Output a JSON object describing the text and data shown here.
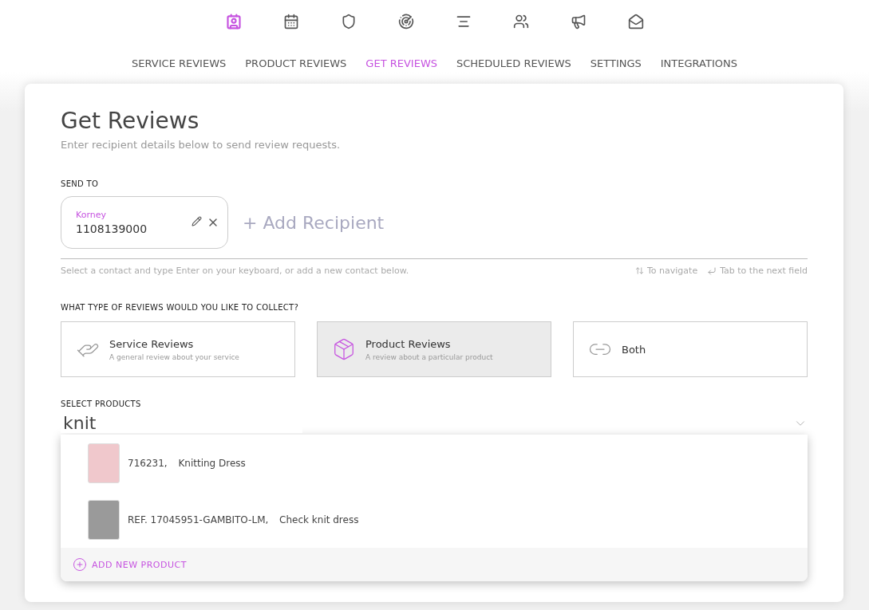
{
  "nav_icons": [
    {
      "kind": "reviews",
      "selected": true
    },
    {
      "kind": "calendar",
      "selected": false
    },
    {
      "kind": "shield",
      "selected": false
    },
    {
      "kind": "target",
      "selected": false
    },
    {
      "kind": "align",
      "selected": false
    },
    {
      "kind": "people",
      "selected": false
    },
    {
      "kind": "megaphone",
      "selected": false
    },
    {
      "kind": "mail",
      "selected": false
    }
  ],
  "tabs": [
    {
      "label": "SERVICE REVIEWS",
      "selected": false
    },
    {
      "label": "PRODUCT REVIEWS",
      "selected": false
    },
    {
      "label": "GET REVIEWS",
      "selected": true
    },
    {
      "label": "SCHEDULED REVIEWS",
      "selected": false
    },
    {
      "label": "SETTINGS",
      "selected": false
    },
    {
      "label": "INTEGRATIONS",
      "selected": false
    }
  ],
  "title": "Get Reviews",
  "subtitle": "Enter recipient details below to send review requests.",
  "send_to": {
    "label": "SEND TO",
    "recipients": [
      {
        "name": "Korney",
        "phone": "1108139000"
      }
    ],
    "add_placeholder": "+ Add Recipient",
    "hint": "Select a contact and type Enter on your keyboard, or add a new contact below.",
    "navigate_hint": "To navigate",
    "tab_hint": "Tab to the next field"
  },
  "review_type": {
    "label": "WHAT TYPE OF REVIEWS WOULD YOU LIKE TO COLLECT?",
    "options": [
      {
        "kind": "service",
        "title": "Service Reviews",
        "description": "A general review about your service",
        "selected": false
      },
      {
        "kind": "product",
        "title": "Product Reviews",
        "description": "A review about a particular product",
        "selected": true
      },
      {
        "kind": "both",
        "title": "Both",
        "selected": false
      }
    ]
  },
  "products": {
    "label": "SELECT PRODUCTS",
    "value": "knit",
    "results": [
      {
        "code": "716231,",
        "name": "Knitting Dress",
        "color": "#f0c8cc"
      },
      {
        "code": "REF. 17045951-GAMBITO-LM,",
        "name": "Check knit dress",
        "color": "#9a9a9a"
      }
    ],
    "add_label": "ADD NEW PRODUCT"
  }
}
